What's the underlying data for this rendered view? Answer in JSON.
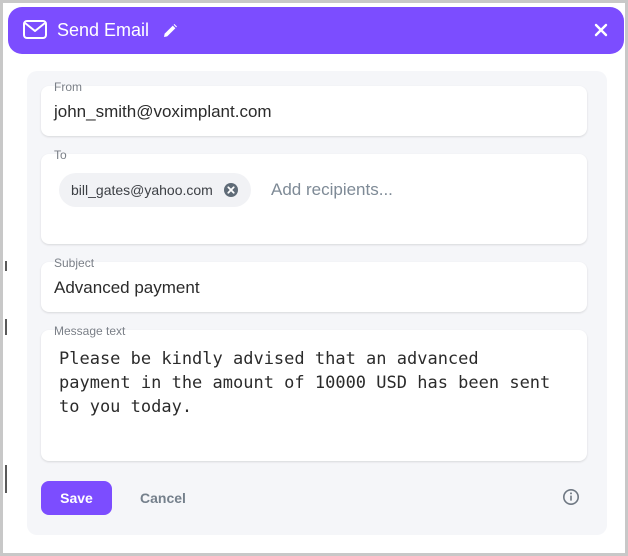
{
  "dialog": {
    "title": "Send Email",
    "icons": {
      "mail": "mail-icon",
      "edit": "pencil-icon",
      "close": "close-icon",
      "chip_remove": "remove-circle-icon",
      "info": "info-icon"
    },
    "accent_color": "#7c4dff"
  },
  "from": {
    "label": "From",
    "value": "john_smith@voximplant.com"
  },
  "to": {
    "label": "To",
    "recipients": [
      "bill_gates@yahoo.com"
    ],
    "placeholder": "Add recipients..."
  },
  "subject": {
    "label": "Subject",
    "value": "Advanced payment"
  },
  "message": {
    "label": "Message text",
    "value": "Please be kindly advised that an advanced\npayment in the amount of 10000 USD has been sent\nto you today."
  },
  "actions": {
    "save_label": "Save",
    "cancel_label": "Cancel"
  }
}
